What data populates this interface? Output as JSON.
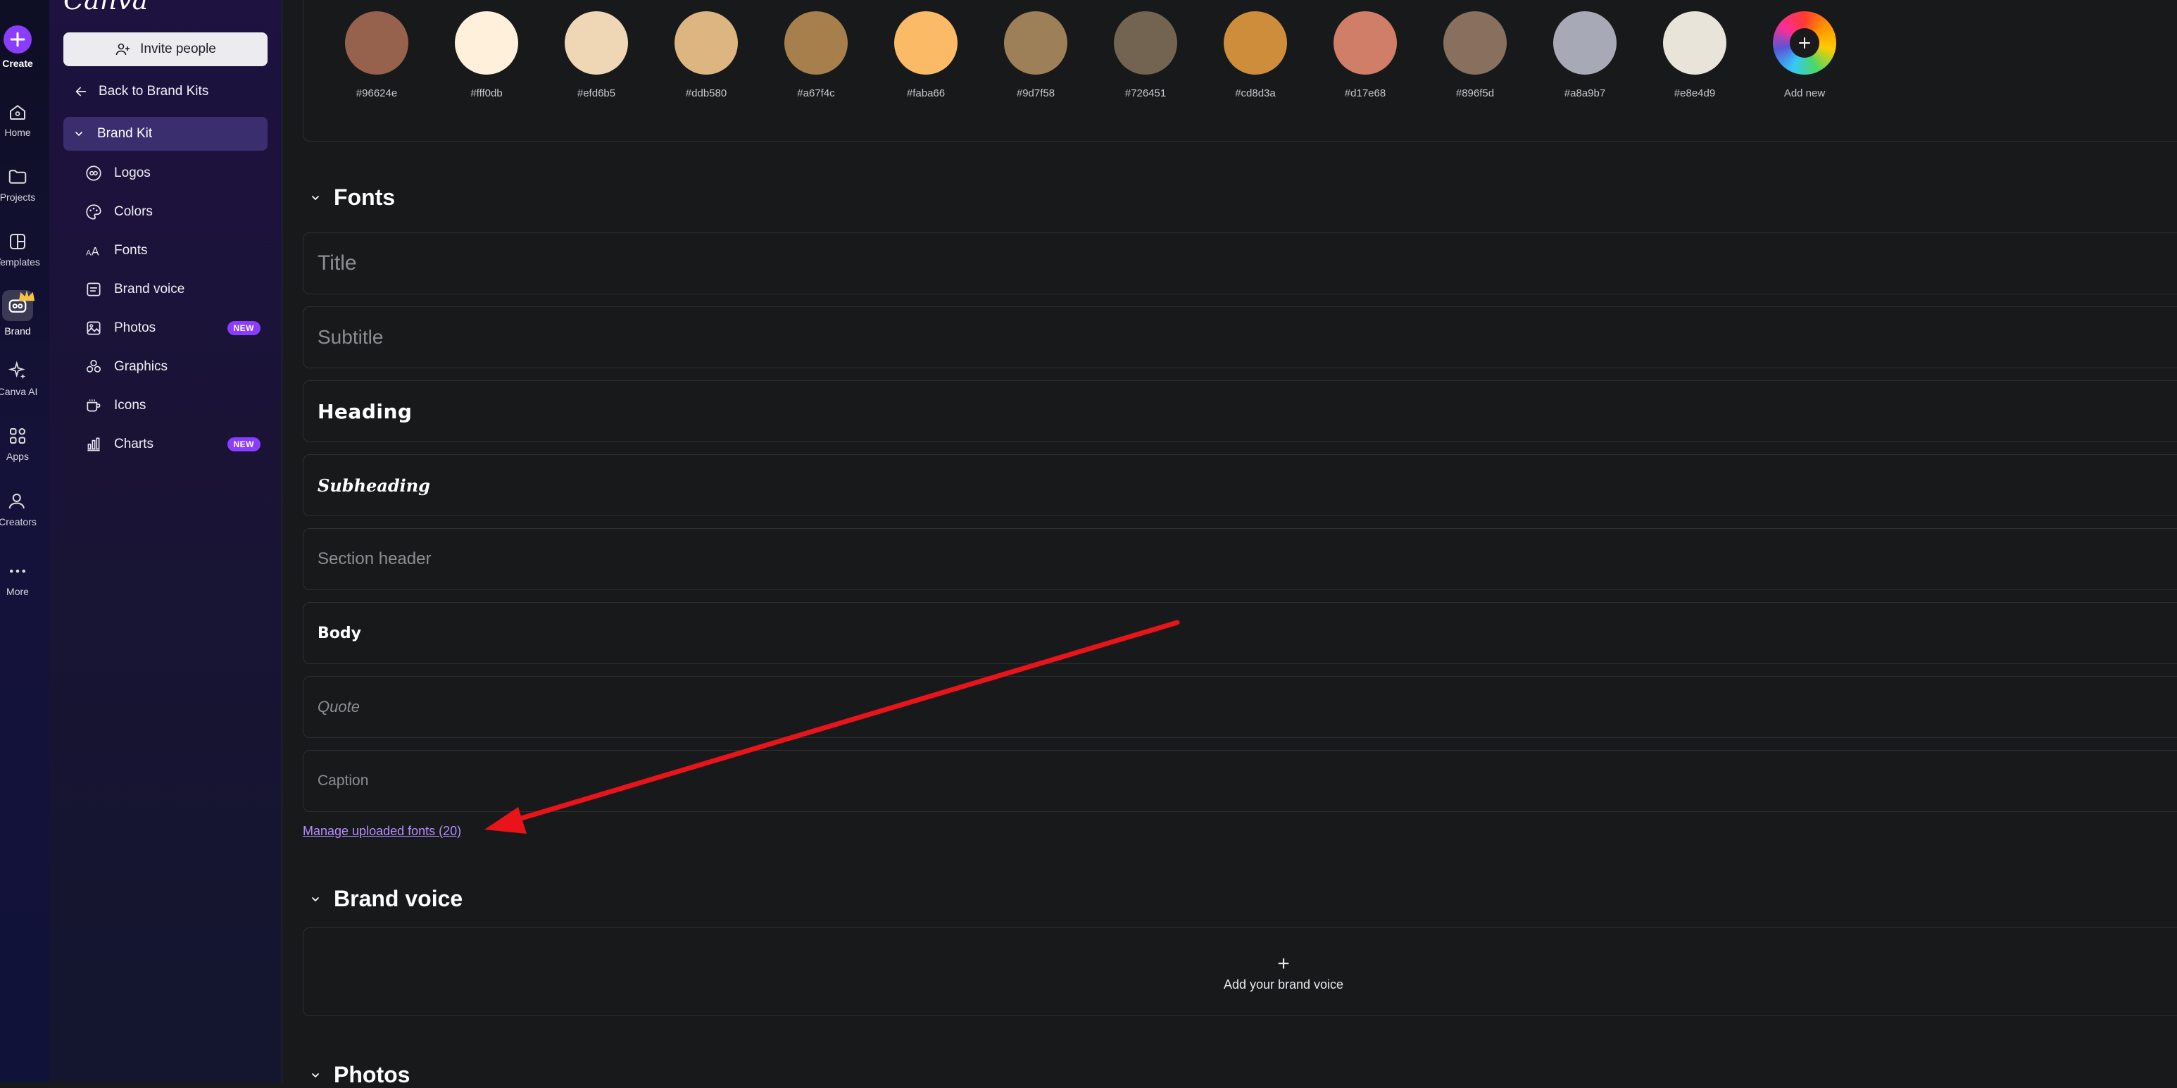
{
  "rail": {
    "items": [
      {
        "label": "Create"
      },
      {
        "label": "Home"
      },
      {
        "label": "Projects"
      },
      {
        "label": "Templates"
      },
      {
        "label": "Brand"
      },
      {
        "label": "Canva AI"
      },
      {
        "label": "Apps"
      },
      {
        "label": "Creators"
      },
      {
        "label": "More"
      }
    ]
  },
  "sidebar": {
    "logo": "Canva",
    "invite_label": "Invite people",
    "back_label": "Back to Brand Kits",
    "brand_kit_label": "Brand Kit",
    "badge_new": "NEW",
    "items": [
      {
        "label": "Logos",
        "icon": "logo-icon"
      },
      {
        "label": "Colors",
        "icon": "palette-icon"
      },
      {
        "label": "Fonts",
        "icon": "font-icon"
      },
      {
        "label": "Brand voice",
        "icon": "brand-voice-icon"
      },
      {
        "label": "Photos",
        "icon": "photo-icon",
        "badge": "NEW"
      },
      {
        "label": "Graphics",
        "icon": "graphics-icon"
      },
      {
        "label": "Icons",
        "icon": "icons-icon"
      },
      {
        "label": "Charts",
        "icon": "chart-icon",
        "badge": "NEW"
      }
    ]
  },
  "colors": {
    "swatches": [
      {
        "hex": "#96624e"
      },
      {
        "hex": "#fff0db"
      },
      {
        "hex": "#efd6b5"
      },
      {
        "hex": "#ddb580"
      },
      {
        "hex": "#a67f4c"
      },
      {
        "hex": "#faba66"
      },
      {
        "hex": "#9d7f58"
      },
      {
        "hex": "#726451"
      },
      {
        "hex": "#cd8d3a"
      },
      {
        "hex": "#d17e68"
      },
      {
        "hex": "#896f5d"
      },
      {
        "hex": "#a8a9b7"
      },
      {
        "hex": "#e8e4d9"
      }
    ],
    "add_new_label": "Add new"
  },
  "fonts": {
    "heading": "Fonts",
    "rows": [
      {
        "label": "Title"
      },
      {
        "label": "Subtitle"
      },
      {
        "label": "Heading"
      },
      {
        "label": "Subheading"
      },
      {
        "label": "Section header"
      },
      {
        "label": "Body"
      },
      {
        "label": "Quote"
      },
      {
        "label": "Caption"
      }
    ],
    "manage_label": "Manage uploaded fonts (20)"
  },
  "brand_voice": {
    "heading": "Brand voice",
    "add_label": "Add your brand voice",
    "plus": "+"
  },
  "photos": {
    "heading": "Photos"
  },
  "theme": {
    "accent": "#8b3dff",
    "link": "#b68cff",
    "annotation_arrow": "#e8141a"
  }
}
